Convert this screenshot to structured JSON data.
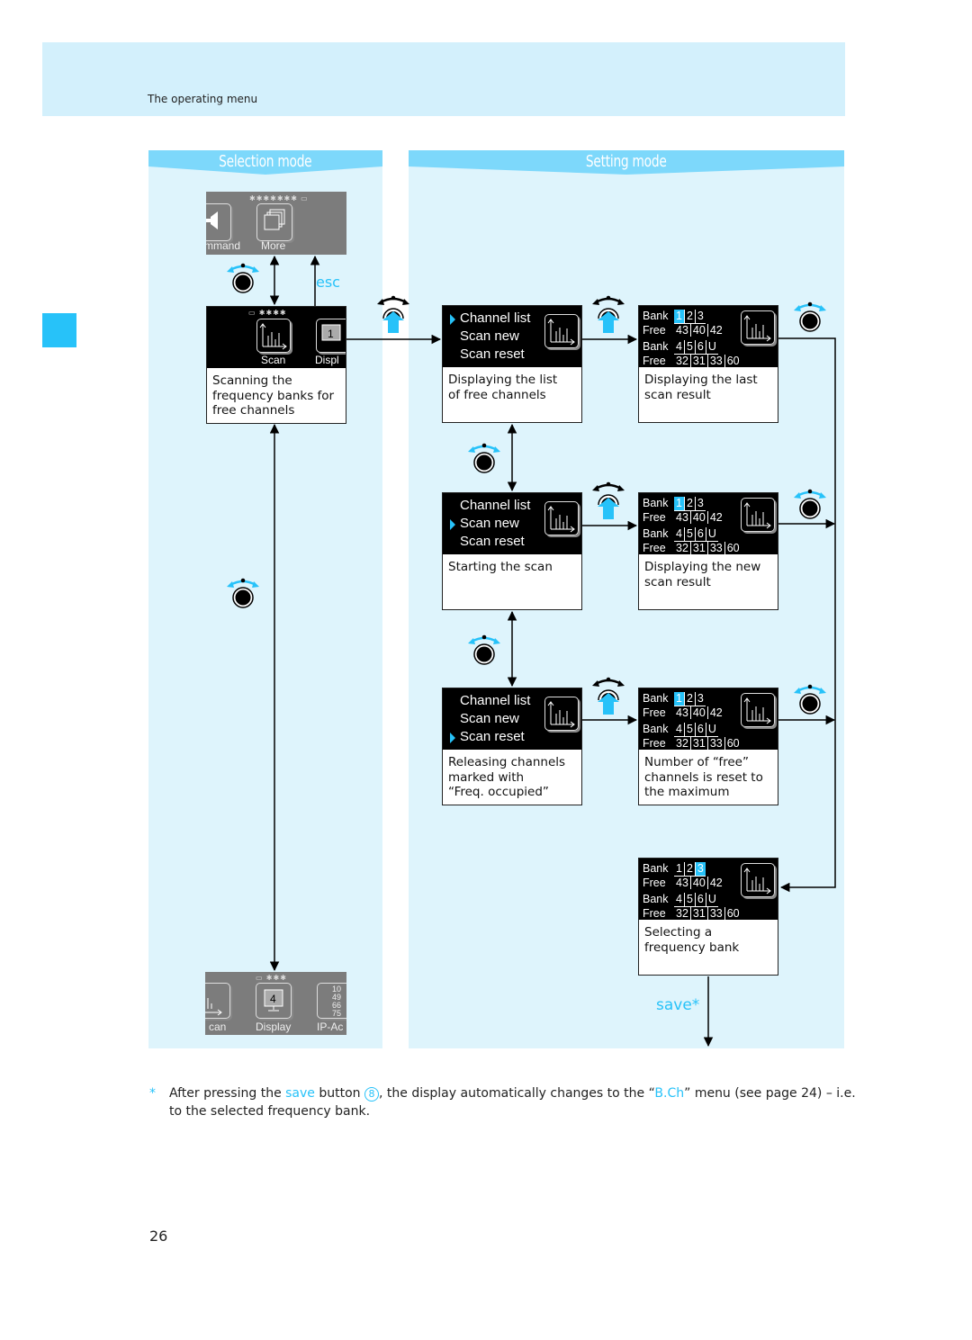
{
  "header": {
    "section_title": "The operating menu"
  },
  "accent_color": "#27c2f9",
  "columns": {
    "selection_mode": "Selection mode",
    "setting_mode": "Setting mode"
  },
  "labels": {
    "esc": "esc",
    "save": "save*"
  },
  "left_screens": {
    "top": {
      "items": [
        "mmand",
        "More"
      ]
    },
    "scan": {
      "items": [
        "Scan",
        "Displ"
      ],
      "description": "Scanning the\nfrequency banks for\nfree channels"
    },
    "bottom": {
      "items": [
        "can",
        "Display",
        "IP-Ac"
      ],
      "display_number": "4",
      "ip_digits": [
        "10",
        "49",
        "66",
        "75"
      ]
    }
  },
  "menu_screens": [
    {
      "items": [
        "Channel list",
        "Scan new",
        "Scan reset"
      ],
      "selected": 0,
      "description": "Displaying the list\nof free channels"
    },
    {
      "items": [
        "Channel list",
        "Scan new",
        "Scan reset"
      ],
      "selected": 1,
      "description": "Starting the scan"
    },
    {
      "items": [
        "Channel list",
        "Scan new",
        "Scan reset"
      ],
      "selected": 2,
      "description": "Releasing channels\nmarked with\n“Freq. occupied”"
    }
  ],
  "bank_screens": [
    {
      "selected_bank": "1",
      "description": "Displaying the last\nscan result"
    },
    {
      "selected_bank": "1",
      "description": "Displaying the new\nscan result"
    },
    {
      "selected_bank": "1",
      "description": "Number of “free”\nchannels is reset to\nthe maximum"
    },
    {
      "selected_bank": "3",
      "description": "Selecting a\nfrequency bank"
    }
  ],
  "bank_table": {
    "bank_label": "Bank",
    "free_label": "Free",
    "row1_banks": [
      "1",
      "2",
      "3"
    ],
    "row1_free": [
      "43",
      "40",
      "42"
    ],
    "row2_banks": [
      "4",
      "5",
      "6",
      "U"
    ],
    "row2_free": [
      "32",
      "31",
      "33",
      "60"
    ]
  },
  "footnote": {
    "star": "*",
    "part1": "After pressing the ",
    "save": "save",
    "part2": " button ",
    "button_number": "8",
    "part3": ", the display automatically changes to the “",
    "menu": "B.Ch",
    "part4": "” menu (see page 24) – i.e. to the selected frequency bank."
  },
  "page_number": "26"
}
